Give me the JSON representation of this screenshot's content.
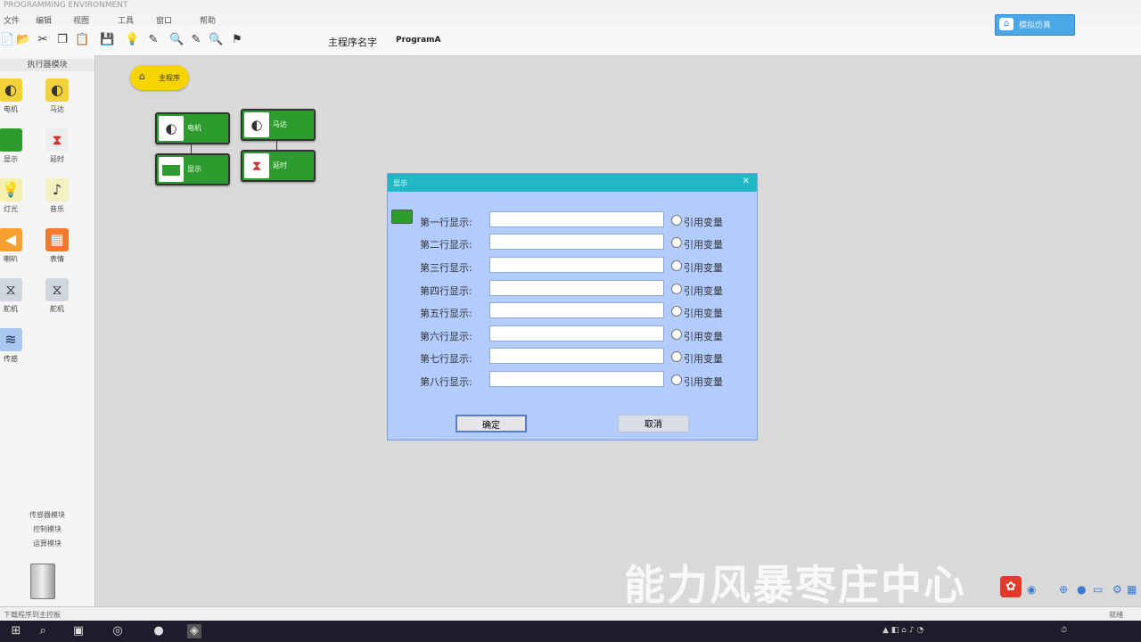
{
  "title_bar": {
    "text": "PROGRAMMING ENVIRONMENT"
  },
  "menu": {
    "items": [
      "文件",
      "编辑",
      "视图",
      "工具",
      "窗口",
      "帮助"
    ]
  },
  "toolbar": {
    "program_label": "主程序名字",
    "program_name": "ProgramA",
    "icons": [
      "new-icon",
      "open-icon",
      "cut-icon",
      "copy-icon",
      "paste-icon",
      "save-icon",
      "bulb-icon",
      "pen-icon",
      "pen-icon",
      "zoom-icon",
      "zoom-icon",
      "flag-icon"
    ],
    "top_right_button": "模拟仿真"
  },
  "left_panel": {
    "header": "执行器模块",
    "components": [
      {
        "label": "电机",
        "icon": "motor-icon"
      },
      {
        "label": "马达",
        "icon": "motor-icon"
      },
      {
        "label": "显示",
        "icon": "display-icon"
      },
      {
        "label": "延时",
        "icon": "timer-icon"
      },
      {
        "label": "灯光",
        "icon": "bulb-icon"
      },
      {
        "label": "音乐",
        "icon": "music-icon"
      },
      {
        "label": "喇叭",
        "icon": "speaker-icon"
      },
      {
        "label": "表情",
        "icon": "grid-icon"
      },
      {
        "label": "舵机",
        "icon": "servo-icon"
      },
      {
        "label": "舵机",
        "icon": "servo-icon"
      },
      {
        "label": "传感",
        "icon": "sensor-icon"
      }
    ],
    "footer_links": [
      "传感器模块",
      "控制模块",
      "运算模块"
    ]
  },
  "canvas": {
    "start_node": "主程序",
    "blocks": [
      {
        "label": "电机",
        "icon": "motor-icon"
      },
      {
        "label": "马达",
        "icon": "motor-icon"
      },
      {
        "label": "显示",
        "icon": "display-icon"
      },
      {
        "label": "延时",
        "icon": "timer-icon"
      }
    ]
  },
  "dialog": {
    "title": "显示",
    "rows": [
      {
        "label": "第一行显示:",
        "value": "",
        "var_label": "引用变量"
      },
      {
        "label": "第二行显示:",
        "value": "",
        "var_label": "引用变量"
      },
      {
        "label": "第三行显示:",
        "value": "",
        "var_label": "引用变量"
      },
      {
        "label": "第四行显示:",
        "value": "",
        "var_label": "引用变量"
      },
      {
        "label": "第五行显示:",
        "value": "",
        "var_label": "引用变量"
      },
      {
        "label": "第六行显示:",
        "value": "",
        "var_label": "引用变量"
      },
      {
        "label": "第七行显示:",
        "value": "",
        "var_label": "引用变量"
      },
      {
        "label": "第八行显示:",
        "value": "",
        "var_label": "引用变量"
      }
    ],
    "ok": "确定",
    "cancel": "取消"
  },
  "status_bar": {
    "left": "下载程序到主控板",
    "right": "就绪"
  },
  "watermark": "能力风暴枣庄中心",
  "colors": {
    "dialog_bg": "#b2ccff",
    "dialog_title": "#1fb8c4",
    "block_green": "#2e9b2e",
    "start_yellow": "#f5d400"
  }
}
